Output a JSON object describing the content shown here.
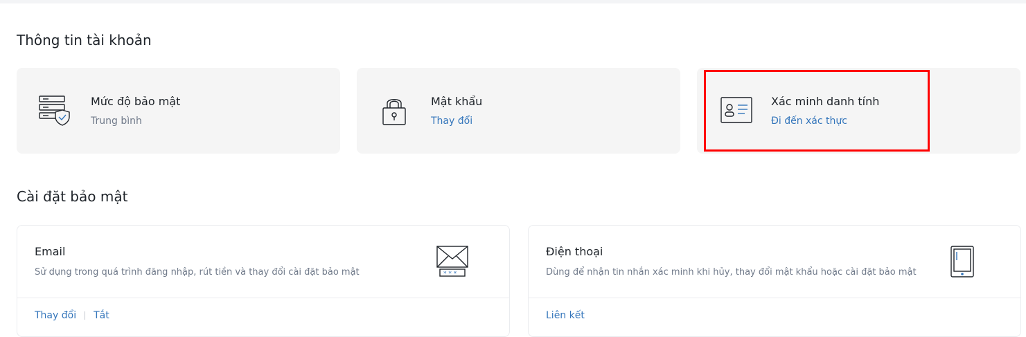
{
  "account_info": {
    "title": "Thông tin tài khoản",
    "cards": [
      {
        "title": "Mức độ bảo mật",
        "subtitle": "Trung bình",
        "icon": "security-level-icon"
      },
      {
        "title": "Mật khẩu",
        "link": "Thay đổi",
        "icon": "padlock-icon"
      },
      {
        "title": "Xác minh danh tính",
        "link": "Đi đến xác thực",
        "icon": "id-card-icon"
      }
    ]
  },
  "security_settings": {
    "title": "Cài đặt bảo mật",
    "cards": [
      {
        "title": "Email",
        "description": "Sử dụng trong quá trình đăng nhập, rút tiền và thay đổi cài đặt bảo mật",
        "actions": [
          "Thay đổi",
          "Tắt"
        ],
        "icon": "envelope-icon"
      },
      {
        "title": "Điện thoại",
        "description": "Dùng để nhận tin nhắn xác minh khi hủy, thay đổi mật khẩu hoặc cài đặt bảo mật",
        "actions": [
          "Liên kết"
        ],
        "icon": "phone-icon"
      }
    ]
  },
  "colors": {
    "link": "#3375bb",
    "card_bg": "#f5f5f5",
    "highlight": "#ff0000"
  }
}
